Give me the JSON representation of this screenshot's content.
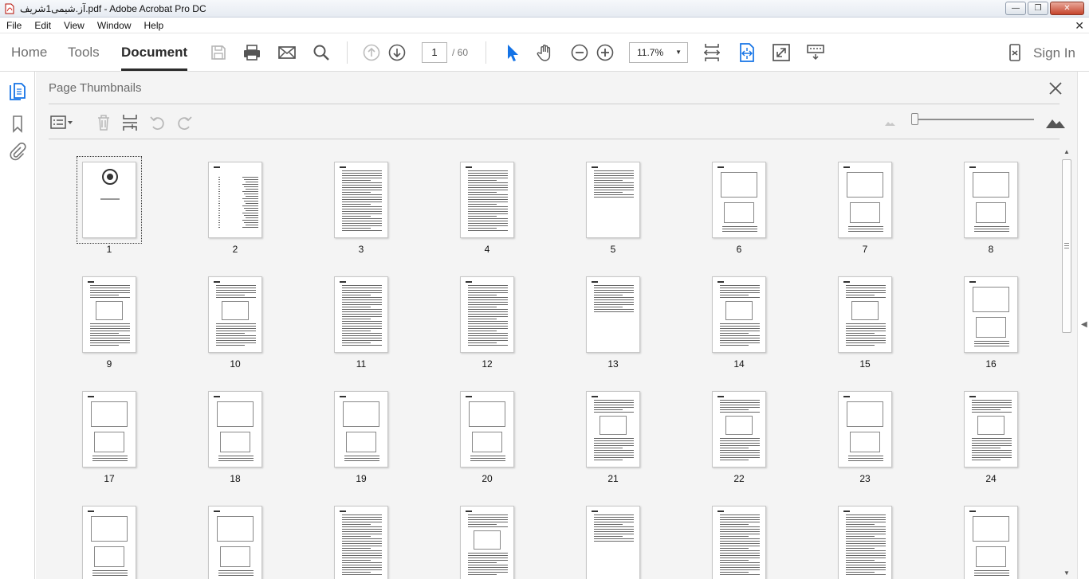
{
  "window": {
    "title": "آز.شیمی1شریف.pdf - Adobe Acrobat Pro DC",
    "controls": {
      "minimize": "—",
      "restore": "❐",
      "close": "✕"
    }
  },
  "menu": {
    "items": [
      "File",
      "Edit",
      "View",
      "Window",
      "Help"
    ],
    "close": "✕"
  },
  "toolbar": {
    "tabs": [
      "Home",
      "Tools",
      "Document"
    ],
    "active_tab": "Document",
    "current_page": "1",
    "total_pages": "/ 60",
    "zoom": "11.7%",
    "sign_in": "Sign In",
    "accent": "#1473e6"
  },
  "panel": {
    "title": "Page Thumbnails",
    "thumbnails": [
      {
        "num": "1"
      },
      {
        "num": "2"
      },
      {
        "num": "3"
      },
      {
        "num": "4"
      },
      {
        "num": "5"
      },
      {
        "num": "6"
      },
      {
        "num": "7"
      },
      {
        "num": "8"
      },
      {
        "num": "9"
      },
      {
        "num": "10"
      },
      {
        "num": "11"
      },
      {
        "num": "12"
      },
      {
        "num": "13"
      },
      {
        "num": "14"
      },
      {
        "num": "15"
      },
      {
        "num": "16"
      },
      {
        "num": "17"
      },
      {
        "num": "18"
      },
      {
        "num": "19"
      },
      {
        "num": "20"
      },
      {
        "num": "21"
      },
      {
        "num": "22"
      },
      {
        "num": "23"
      },
      {
        "num": "24"
      },
      {
        "num": ""
      },
      {
        "num": ""
      },
      {
        "num": ""
      },
      {
        "num": ""
      },
      {
        "num": ""
      },
      {
        "num": ""
      },
      {
        "num": ""
      },
      {
        "num": ""
      }
    ],
    "selected_page": "1"
  }
}
